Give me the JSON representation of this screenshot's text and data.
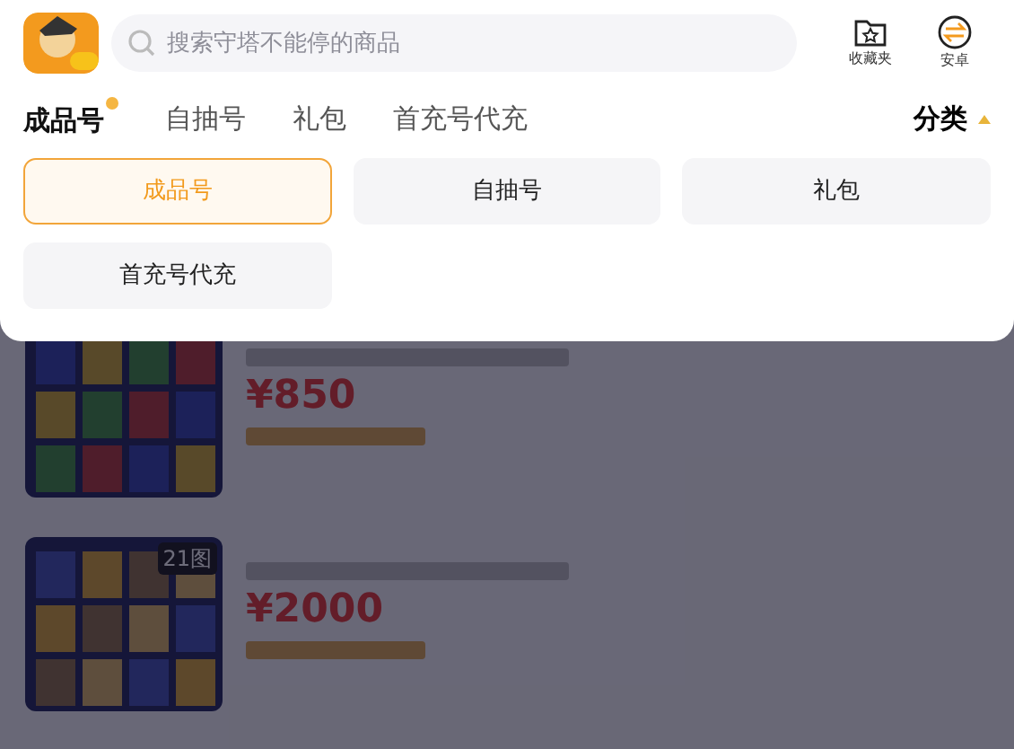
{
  "search": {
    "placeholder": "搜索守塔不能停的商品"
  },
  "actions": [
    {
      "kind": "favorites",
      "label": "收藏夹"
    },
    {
      "kind": "android",
      "label": "安卓"
    }
  ],
  "tabs": [
    {
      "label": "成品号",
      "selected": true,
      "dot": true
    },
    {
      "label": "自抽号",
      "selected": false,
      "dot": false
    },
    {
      "label": "礼包",
      "selected": false,
      "dot": false
    },
    {
      "label": "首充号代充",
      "selected": false,
      "dot": false
    }
  ],
  "category": {
    "label": "分类",
    "expanded": true
  },
  "category_options": [
    {
      "label": "成品号",
      "selected": true
    },
    {
      "label": "自抽号",
      "selected": false
    },
    {
      "label": "礼包",
      "selected": false
    },
    {
      "label": "首充号代充",
      "selected": false
    }
  ],
  "listings": [
    {
      "price": "¥850"
    },
    {
      "price": "¥2000",
      "image_count": "21图"
    }
  ]
}
